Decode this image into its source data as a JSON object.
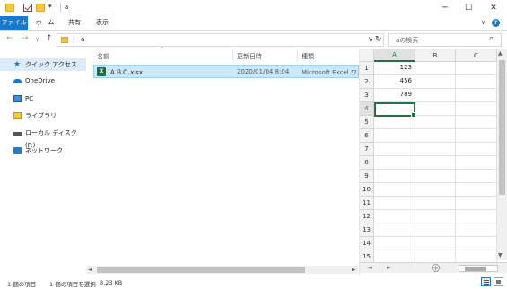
{
  "window": {
    "title": "a",
    "buttons": {
      "minimize": "─",
      "maximize": "☐",
      "close": "✕"
    }
  },
  "ribbon": {
    "tabs": [
      "ファイル",
      "ホーム",
      "共有",
      "表示"
    ],
    "collapse": "∨",
    "help": "?"
  },
  "nav": {
    "back": "←",
    "forward": "→",
    "recent": "∨",
    "up": "↑",
    "path_sep": "›",
    "path": "a",
    "dropdown": "∨",
    "refresh": "↻",
    "search_placeholder": "aの検索",
    "search_icon": "⌕"
  },
  "sidebar": {
    "items": [
      {
        "label": "クイック アクセス",
        "icon": "star-icon"
      },
      {
        "label": "OneDrive",
        "icon": "cloud-icon"
      },
      {
        "label": "PC",
        "icon": "pc-icon"
      },
      {
        "label": "ライブラリ",
        "icon": "library-icon"
      },
      {
        "label": "ローカル ディスク (F:)",
        "icon": "disk-icon"
      },
      {
        "label": "ネットワーク",
        "icon": "network-icon"
      }
    ]
  },
  "filelist": {
    "sort_indicator": "^",
    "columns": [
      "名前",
      "更新日時",
      "種類"
    ],
    "files": [
      {
        "name": "ＡＢＣ.xlsx",
        "modified": "2020/01/04 8:04",
        "type": "Microsoft Excel ワ..."
      }
    ],
    "icon_letter": "X"
  },
  "preview": {
    "columns": [
      "A",
      "B",
      "C"
    ],
    "rows": [
      "1",
      "2",
      "3",
      "4",
      "5",
      "6",
      "7",
      "8",
      "9",
      "10",
      "11",
      "12",
      "13",
      "14",
      "15"
    ],
    "values": [
      "123",
      "456",
      "789"
    ],
    "selected_column": "A",
    "selected_row": "4",
    "sheet_plus": "+",
    "sheet_nav": [
      "◄",
      "►"
    ]
  },
  "statusbar": {
    "item_count": "1 個の項目",
    "selection": "1 個の項目を選択",
    "size": "8.23 KB"
  },
  "colors": {
    "accent": "#1979ca",
    "excel_green": "#217346",
    "selection_bg": "#cce8ff"
  }
}
